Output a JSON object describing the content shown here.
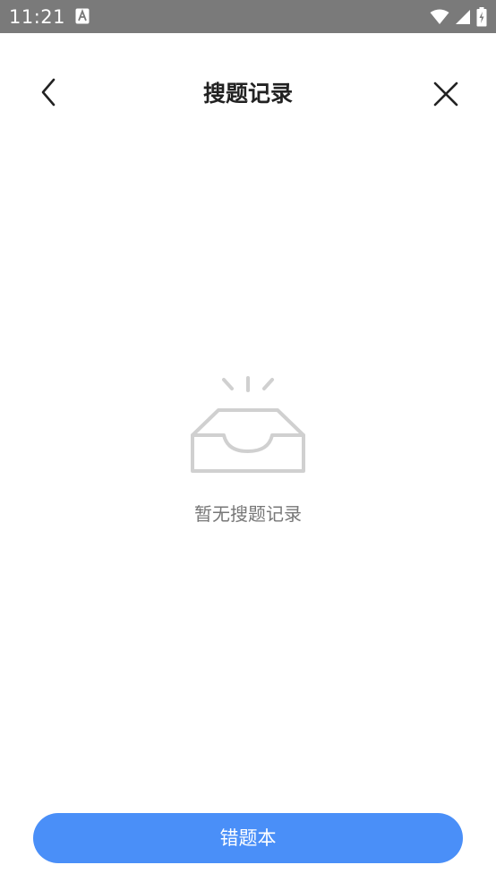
{
  "status_bar": {
    "time": "11:21",
    "icons": [
      "text-a-icon",
      "wifi-icon",
      "signal-icon",
      "battery-charging-icon"
    ]
  },
  "header": {
    "title": "搜题记录",
    "back_icon": "chevron-left-icon",
    "close_icon": "close-icon"
  },
  "empty_state": {
    "icon": "empty-inbox-icon",
    "message": "暂无搜题记录"
  },
  "footer": {
    "button_label": "错题本"
  },
  "colors": {
    "status_bar_bg": "#7a7a7a",
    "accent": "#4a8ff8",
    "title_text": "#222222",
    "muted_text": "#777777",
    "icon_gray": "#d0d0d0"
  }
}
